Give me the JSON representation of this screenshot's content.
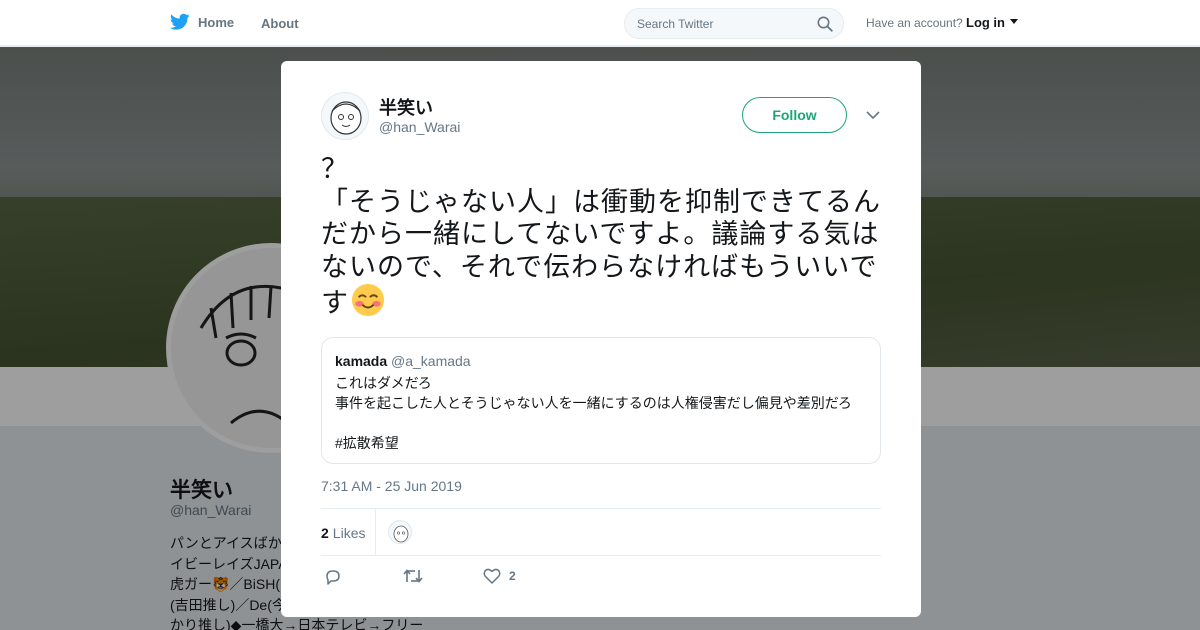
{
  "nav": {
    "home_label": "Home",
    "about_label": "About",
    "search_placeholder": "Search Twitter",
    "account_prompt": "Have an account?",
    "login_label": "Log in"
  },
  "profile": {
    "name": "半笑い",
    "handle": "@han_Warai",
    "bio_visible": "パンとアイスばか\nイビーレイズJAPA\n虎ガー🐯／BiSH(\n(吉田推し)／De(今\nかり推し)◆一橋大→日本テレビ→フリー"
  },
  "tweet": {
    "author_name": "半笑い",
    "author_handle": "@han_Warai",
    "follow_label": "Follow",
    "text": "？\n「そうじゃない人」は衝動を抑制できてるんだから一緒にしてないですよ。議論する気はないので、それで伝わらなければもういいです",
    "emoji": "smiling-face-with-blush-icon",
    "quoted": {
      "name": "kamada",
      "handle": "@a_kamada",
      "text": "これはダメだろ\n事件を起こした人とそうじゃない人を一緒にするのは人権侵害だし偏見や差別だろ\n\n#拡散希望"
    },
    "timestamp": "7:31 AM - 25 Jun 2019",
    "likes_count": "2",
    "likes_label": "Likes",
    "like_action_count": "2"
  },
  "colors": {
    "twitter_blue": "#1da1f2",
    "follow_green": "#1da57a",
    "text_primary": "#14171a",
    "text_secondary": "#657786"
  }
}
